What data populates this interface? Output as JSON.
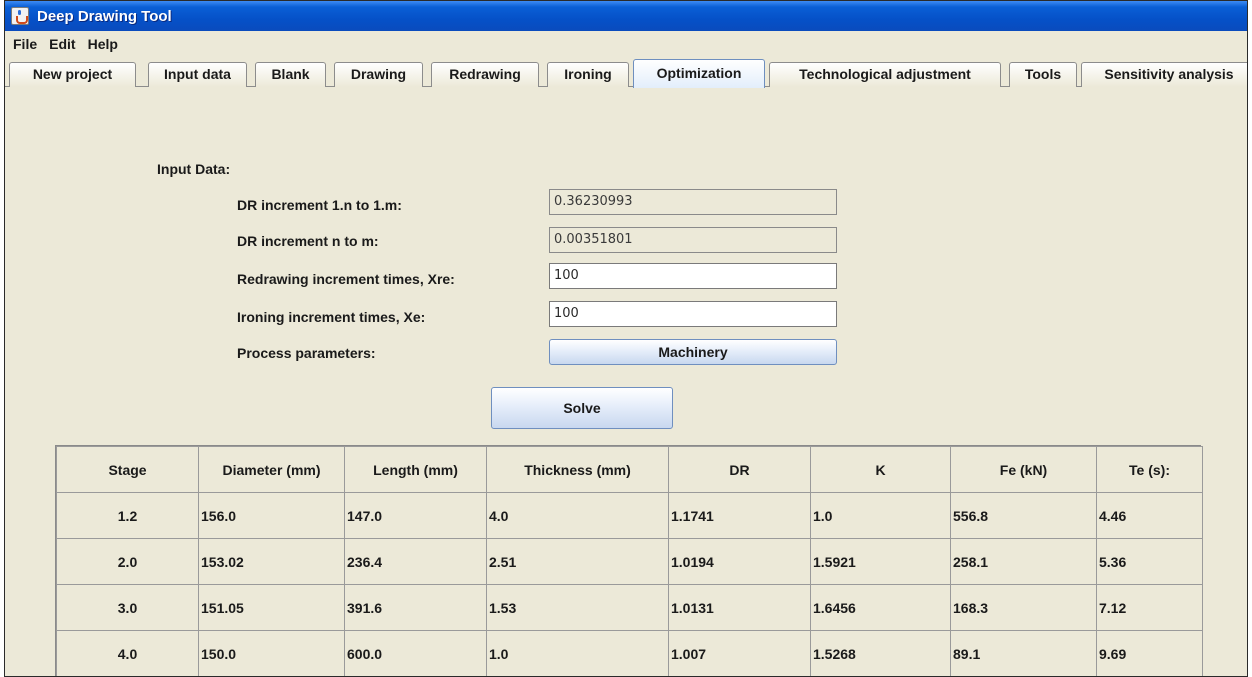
{
  "window": {
    "title": "Deep Drawing Tool"
  },
  "menu": [
    "File",
    "Edit",
    "Help"
  ],
  "tabs": [
    "New project",
    "Input data",
    "Blank",
    "Drawing",
    "Redrawing",
    "Ironing",
    "Optimization",
    "Technological adjustment",
    "Tools",
    "Sensitivity analysis"
  ],
  "active_tab": "Optimization",
  "form": {
    "section_title": "Input Data:",
    "dr_increment_1n_label": "DR increment 1.n to 1.m:",
    "dr_increment_1n_value": "0.36230993",
    "dr_increment_n_label": "DR increment n to m:",
    "dr_increment_n_value": "0.00351801",
    "redrawing_label": "Redrawing increment times, Xre:",
    "redrawing_value": "100",
    "ironing_label": "Ironing increment times, Xe:",
    "ironing_value": "100",
    "process_label": "Process parameters:",
    "machinery_button": "Machinery",
    "solve_button": "Solve"
  },
  "table": {
    "headers": [
      "Stage",
      "Diameter (mm)",
      "Length (mm)",
      "Thickness (mm)",
      "DR",
      "K",
      "Fe (kN)",
      "Te (s):"
    ],
    "rows": [
      [
        "1.2",
        "156.0",
        "147.0",
        "4.0",
        "1.1741",
        "1.0",
        "556.8",
        "4.46"
      ],
      [
        "2.0",
        "153.02",
        "236.4",
        "2.51",
        "1.0194",
        "1.5921",
        "258.1",
        "5.36"
      ],
      [
        "3.0",
        "151.05",
        "391.6",
        "1.53",
        "1.0131",
        "1.6456",
        "168.3",
        "7.12"
      ],
      [
        "4.0",
        "150.0",
        "600.0",
        "1.0",
        "1.007",
        "1.5268",
        "89.1",
        "9.69"
      ]
    ]
  }
}
